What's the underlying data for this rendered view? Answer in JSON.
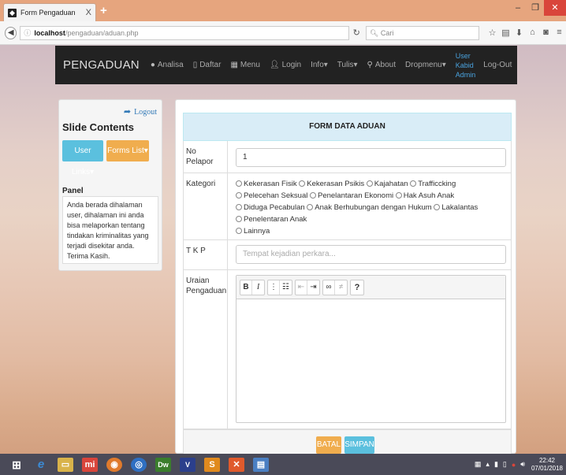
{
  "browser": {
    "tab_title": "Form Pengaduan",
    "tab_close": "X",
    "new_tab": "+",
    "url_host": "localhost",
    "url_path": "/pengaduan/aduan.php",
    "search_placeholder": "Cari"
  },
  "navbar": {
    "brand": "PENGADUAN",
    "items": [
      {
        "label": "Analisa",
        "icon": "globe-icon"
      },
      {
        "label": "Daftar",
        "icon": "clipboard-icon"
      },
      {
        "label": "Menu",
        "icon": "grid-icon"
      },
      {
        "label": "Login",
        "icon": "user-icon"
      },
      {
        "label": "Info▾",
        "icon": ""
      },
      {
        "label": "Tulis▾",
        "icon": ""
      }
    ],
    "about": "About",
    "dropmenu": "Dropmenu▾",
    "user_links": [
      "User",
      "Kabid",
      "Admin"
    ],
    "logout": "Log-Out"
  },
  "sidebar": {
    "logout": "Logout",
    "title": "Slide Contents",
    "user_links_btn": "User Links▾",
    "forms_list_btn": "Forms List▾",
    "panel_title": "Panel",
    "panel_text": "Anda berada dihalaman user, dihalaman ini anda bisa melaporkan tentang tindakan kriminalitas yang terjadi disekitar anda. Terima Kasih."
  },
  "form": {
    "header": "FORM DATA ADUAN",
    "no_pelapor_label": "No Pelapor",
    "no_pelapor_value": "1",
    "kategori_label": "Kategori",
    "kategori_options": [
      "Kekerasan Fisik",
      "Kekerasan Psikis",
      "Kajahatan",
      "Trafficcking",
      "Pelecehan Seksual",
      "Penelantaran Ekonomi",
      "Hak Asuh Anak",
      "Diduga Pecabulan",
      "Anak Berhubungan dengan Hukum",
      "Lakalantas",
      "Penelentaran Anak",
      "Lainnya"
    ],
    "tkp_label": "T K P",
    "tkp_placeholder": "Tempat kejadian perkara...",
    "uraian_label": "Uraian Pengaduan",
    "batal": "BATAL",
    "simpan": "SIMPAN"
  },
  "taskbar": {
    "time": "22:42",
    "date": "07/01/2018"
  }
}
